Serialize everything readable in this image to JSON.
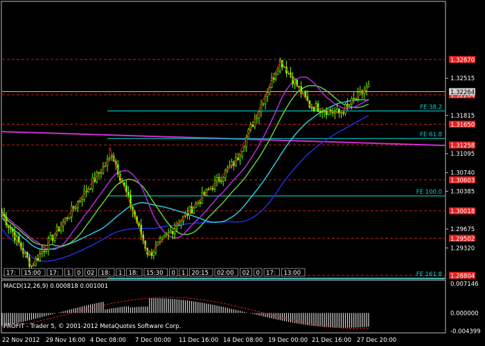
{
  "window": {
    "macd_label": "MACD(12,26,9) 0.000818 0.001001",
    "watermark": "PROFIT - Trader 5, © 2001-2012 MetaQuotes Software Corp."
  },
  "colors": {
    "background": "#000000",
    "candle": "#7cfc00",
    "grid_level": "#c81e1e",
    "fib": "#00d0d0",
    "zigzag": "#e02020",
    "ma_fast": "#b030e0",
    "ma_green": "#60d040",
    "ma_cyan": "#30c8e0",
    "ma_blue": "#2030e0",
    "magenta_line": "#d030d0",
    "current_price_line": "#d0d0d0",
    "histogram": "#d8d8d8",
    "signal": "#e02020",
    "red_tag": "#e02020"
  },
  "chart_data": {
    "type": "candlestick",
    "ylim": [
      1.2875,
      1.3395
    ],
    "y_ticks": [
      "1.32515",
      "1.31815",
      "1.31095",
      "1.30740",
      "1.30385",
      "1.29675",
      "1.29320"
    ],
    "red_price_tags": [
      "1.32870",
      "1.32204",
      "1.31650",
      "1.31258",
      "1.30603",
      "1.30018",
      "1.29502",
      "1.28804"
    ],
    "current_price_tag": "1.32264",
    "x_labels": [
      "22 Nov 2012",
      "29 Nov 16:00",
      "4 Dec 08:00",
      "7 Dec 00:00",
      "11 Dec 16:00",
      "14 Dec 08:00",
      "19 Dec 00:00",
      "21 Dec 16:00",
      "27 Dec 20:00"
    ],
    "fib_levels": [
      {
        "label": "FE 38.2",
        "price": 1.319
      },
      {
        "label": "FE 61.8",
        "price": 1.3138
      },
      {
        "label": "FE 100.0",
        "price": 1.303
      },
      {
        "label": "FE 161.8",
        "price": 1.2875
      }
    ],
    "bottom_markers": [
      "17:",
      "15:00",
      "17:",
      "1",
      "0",
      "02",
      "18:",
      "1",
      "18:",
      "15:30",
      "0",
      "1",
      "20:15",
      "02:00",
      "02",
      "0",
      "17:",
      "13:00"
    ],
    "zigzag": [
      [
        1.2996,
        0
      ],
      [
        1.2898,
        0.06
      ],
      [
        1.31,
        0.22
      ],
      [
        1.3122,
        0.22
      ],
      [
        1.2918,
        0.3
      ],
      [
        1.3098,
        0.48
      ],
      [
        1.3285,
        0.57
      ],
      [
        1.32,
        0.63
      ],
      [
        1.3185,
        0.69
      ],
      [
        1.3235,
        0.75
      ]
    ],
    "macd": {
      "label": "MACD(12,26,9) 0.000818 0.001001",
      "y_ticks": [
        "0.007146",
        "0.000000",
        "-0.004399"
      ],
      "ylim": [
        -0.0045,
        0.0073
      ]
    }
  }
}
